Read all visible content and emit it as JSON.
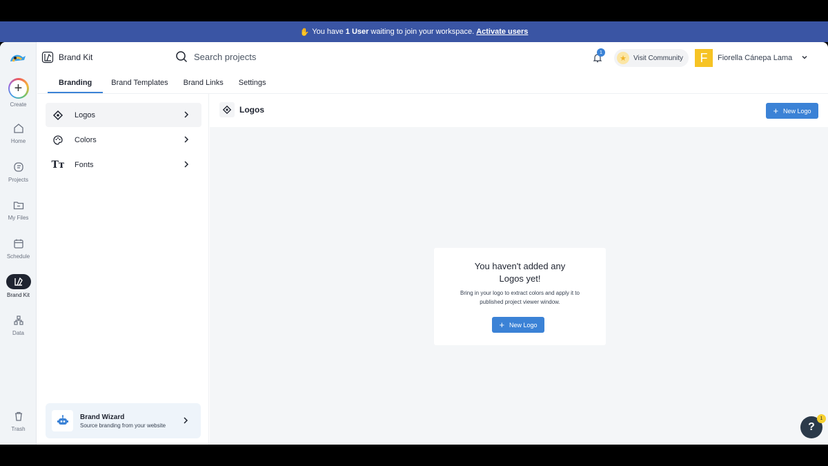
{
  "banner": {
    "prefix": "You have",
    "count": "1 User",
    "suffix": "waiting to join your workspace.",
    "link": "Activate users"
  },
  "rail": {
    "create": "Create",
    "home": "Home",
    "projects": "Projects",
    "my_files": "My Files",
    "schedule": "Schedule",
    "brand_kit": "Brand Kit",
    "data": "Data",
    "trash": "Trash"
  },
  "header": {
    "title": "Brand Kit",
    "search_placeholder": "Search projects",
    "notifications_count": "1",
    "community": "Visit Community",
    "user_initial": "F",
    "user_name": "Fiorella Cánepa Lama"
  },
  "tabs": [
    "Branding",
    "Brand Templates",
    "Brand Links",
    "Settings"
  ],
  "side_menu": [
    "Logos",
    "Colors",
    "Fonts"
  ],
  "wizard": {
    "title": "Brand Wizard",
    "subtitle": "Source branding from your website"
  },
  "main": {
    "title": "Logos",
    "new_logo": "New Logo",
    "empty_title": "You haven't added any Logos yet!",
    "empty_text": "Bring in your logo to extract colors and apply it to published project viewer window.",
    "empty_button": "New Logo"
  },
  "help": {
    "label": "?",
    "badge": "1"
  },
  "colors": {
    "banner": "#3a55a4",
    "accent": "#3b82d6",
    "avatar": "#f6c324"
  }
}
